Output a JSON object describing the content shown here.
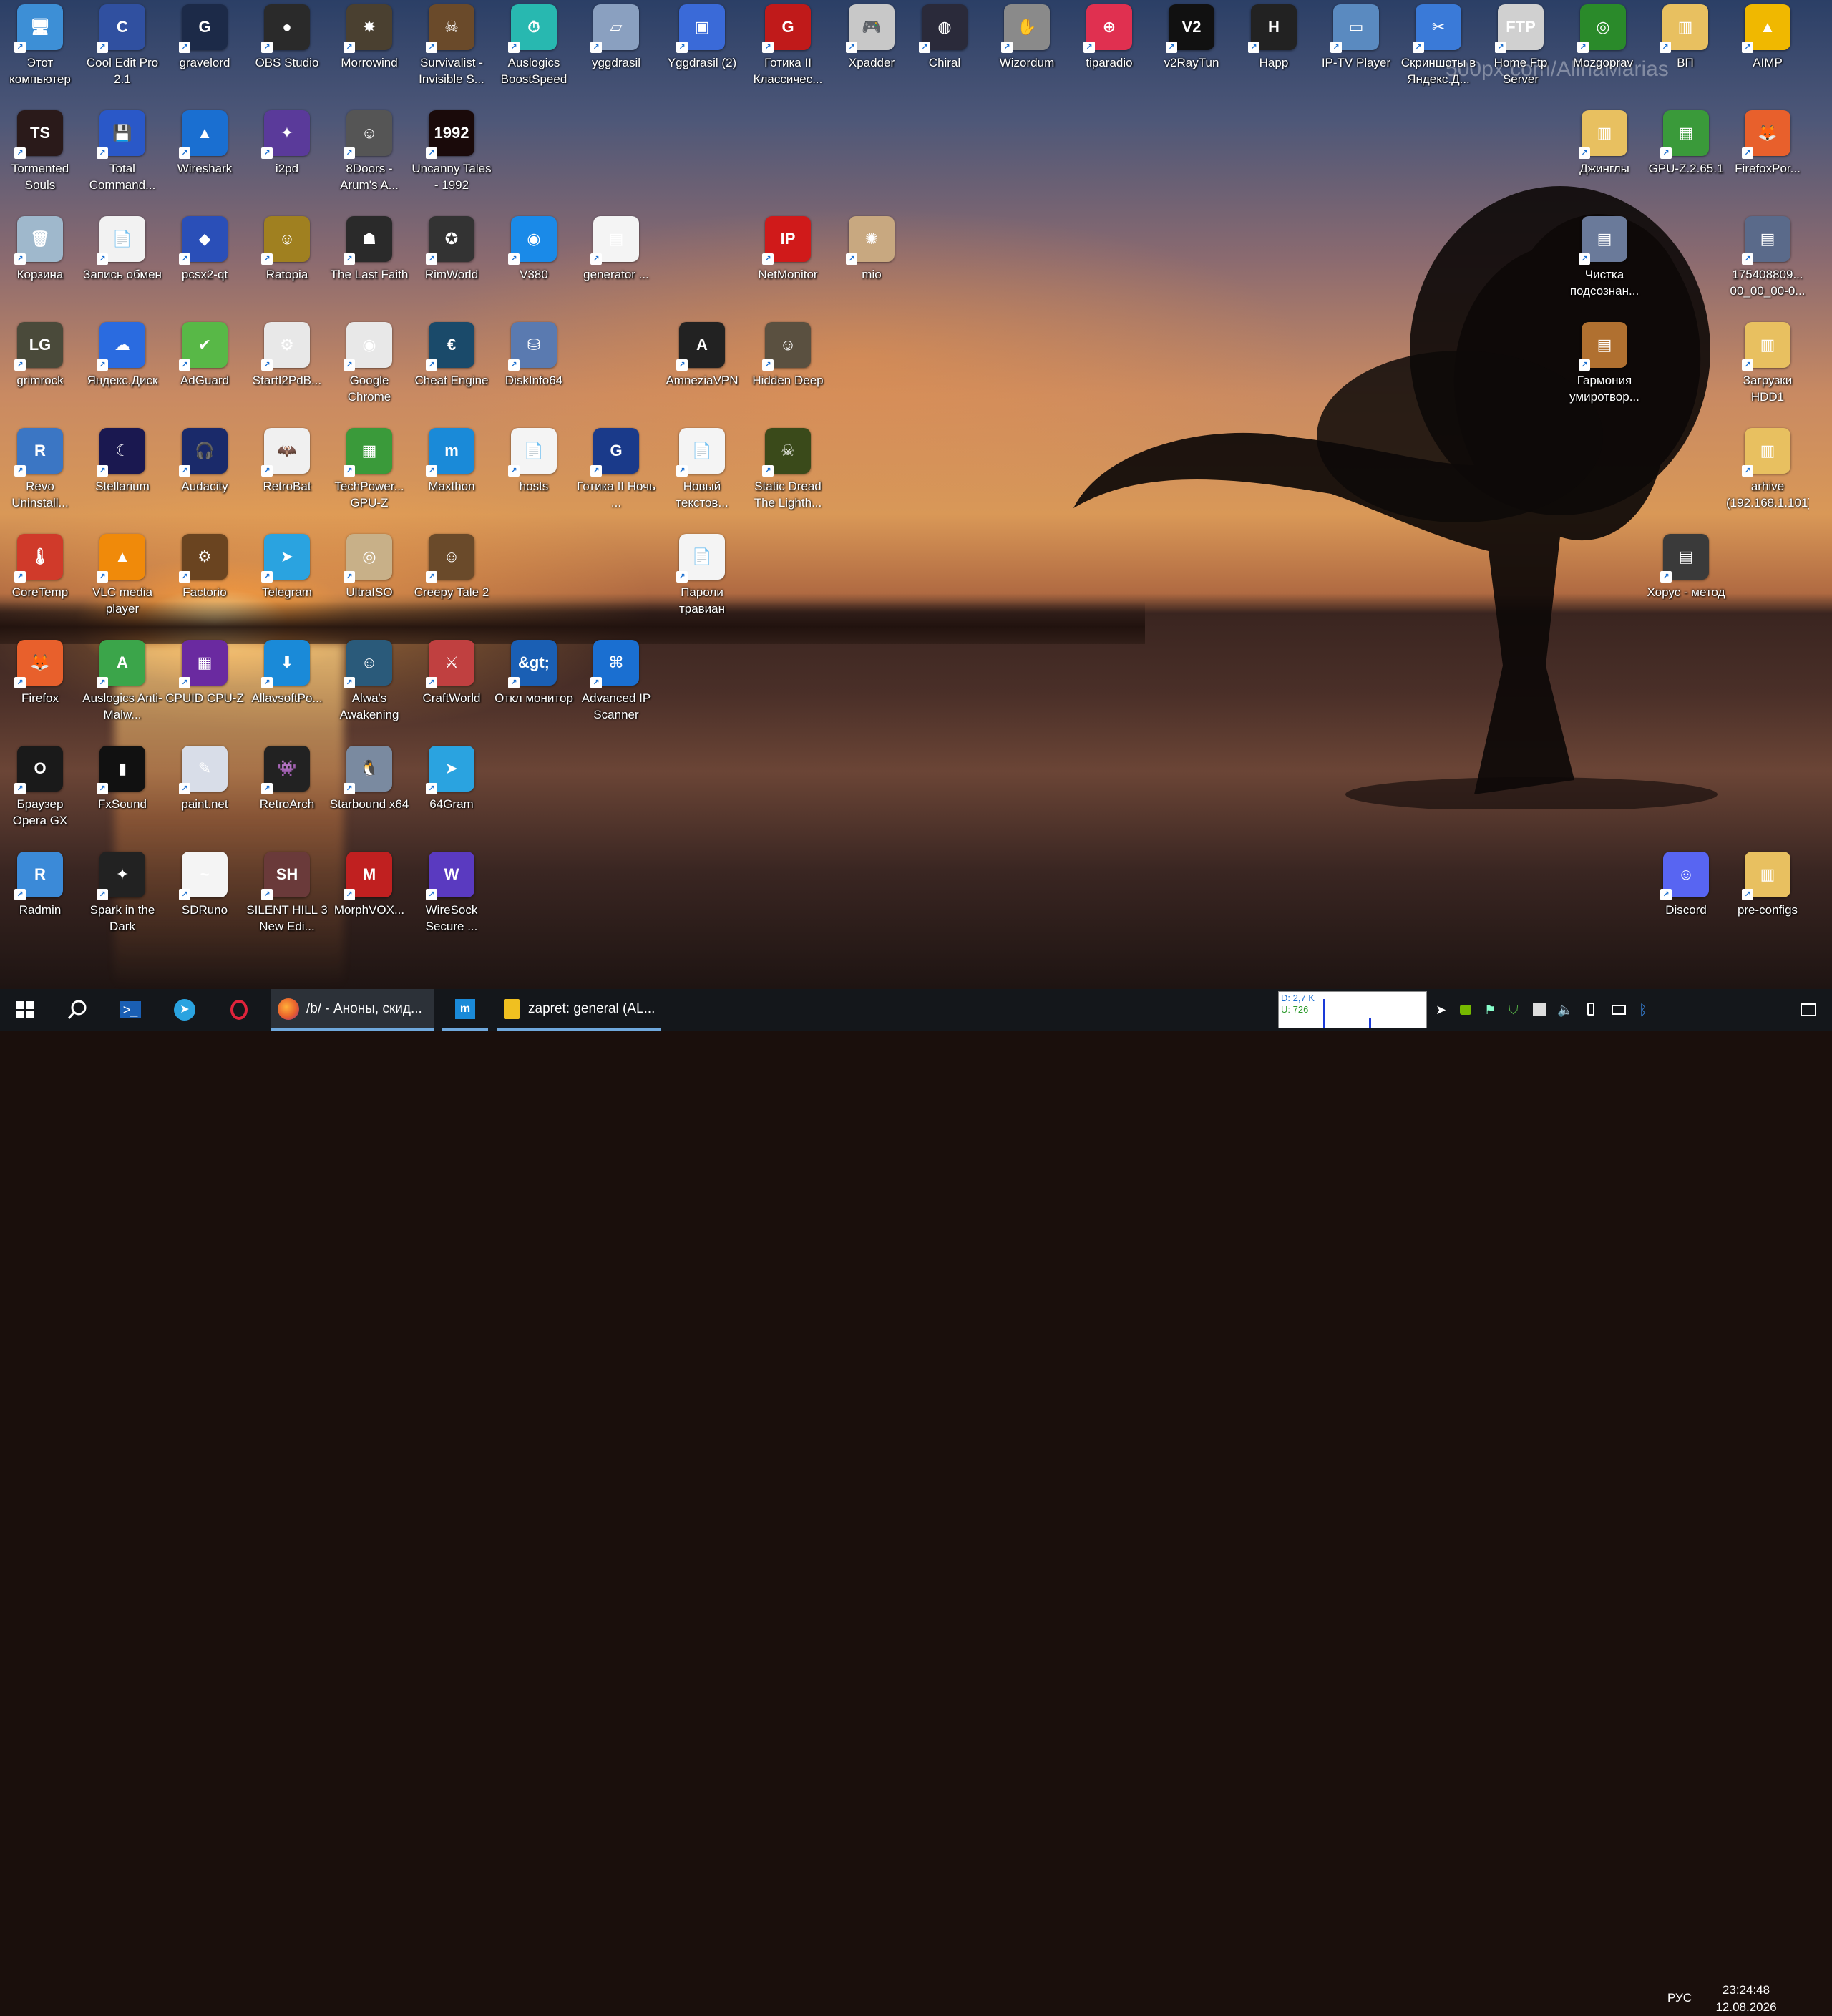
{
  "watermark": "500px.com/AlinaMarias",
  "icons_col1": [
    {
      "label": "Этот компьютер",
      "icon": "computer-icon",
      "color": "#3d8fd6",
      "g": "🖥"
    },
    {
      "label": "Tormented Souls",
      "icon": "game-icon",
      "color": "#2a1a1a",
      "g": "TS"
    },
    {
      "label": "Корзина",
      "icon": "recycle-bin-icon",
      "color": "#9fb8cc",
      "g": "🗑"
    },
    {
      "label": "grimrock",
      "icon": "game-icon",
      "color": "#4a4a3a",
      "g": "LG"
    },
    {
      "label": "Revo Uninstall...",
      "icon": "uninstaller-icon",
      "color": "#3b76c4",
      "g": "R"
    },
    {
      "label": "CoreTemp",
      "icon": "thermometer-icon",
      "color": "#d03a2a",
      "g": "🌡"
    },
    {
      "label": "Firefox",
      "icon": "firefox-icon",
      "color": "#e8602c",
      "g": "🦊"
    },
    {
      "label": "Браузер Opera GX",
      "icon": "opera-icon",
      "color": "#1a1a1a",
      "g": "O"
    },
    {
      "label": "Radmin",
      "icon": "radmin-icon",
      "color": "#3b8ad8",
      "g": "R"
    }
  ],
  "icons_col2": [
    {
      "label": "Cool Edit Pro 2.1",
      "icon": "audio-editor-icon",
      "color": "#3050a0",
      "g": "C"
    },
    {
      "label": "Total Command...",
      "icon": "floppy-icon",
      "color": "#2a58c8",
      "g": "💾"
    },
    {
      "label": "Запись обмен",
      "icon": "document-icon",
      "color": "#f2f2f2",
      "g": "📄"
    },
    {
      "label": "Яндекс.Диск",
      "icon": "cloud-icon",
      "color": "#2a6be0",
      "g": "☁"
    },
    {
      "label": "Stellarium",
      "icon": "moon-icon",
      "color": "#1a1850",
      "g": "☾"
    },
    {
      "label": "VLC media player",
      "icon": "vlc-icon",
      "color": "#f08a0a",
      "g": "▲"
    },
    {
      "label": "Auslogics Anti-Malw...",
      "icon": "shield-icon",
      "color": "#3ba54a",
      "g": "A"
    },
    {
      "label": "FxSound",
      "icon": "equalizer-icon",
      "color": "#111111",
      "g": "▮"
    },
    {
      "label": "Spark in the Dark",
      "icon": "game-icon",
      "color": "#222222",
      "g": "✦"
    }
  ],
  "icons_col3": [
    {
      "label": "gravelord",
      "icon": "game-icon",
      "color": "#1c2a48",
      "g": "G"
    },
    {
      "label": "Wireshark",
      "icon": "shark-fin-icon",
      "color": "#1a6fd1",
      "g": "▲"
    },
    {
      "label": "pcsx2-qt",
      "icon": "playstation-icon",
      "color": "#2a4fb8",
      "g": "◆"
    },
    {
      "label": "AdGuard",
      "icon": "shield-check-icon",
      "color": "#58b847",
      "g": "✔"
    },
    {
      "label": "Audacity",
      "icon": "headphones-icon",
      "color": "#1a2a6a",
      "g": "🎧"
    },
    {
      "label": "Factorio",
      "icon": "gear-icon",
      "color": "#6a4420",
      "g": "⚙"
    },
    {
      "label": "CPUID CPU-Z",
      "icon": "chip-icon",
      "color": "#6a2aa0",
      "g": "▦"
    },
    {
      "label": "paint.net",
      "icon": "paint-icon",
      "color": "#d8dde8",
      "g": "✎"
    },
    {
      "label": "SDRuno",
      "icon": "radio-icon",
      "color": "#f4f4f4",
      "g": "~"
    }
  ],
  "icons_col4": [
    {
      "label": "OBS Studio",
      "icon": "obs-icon",
      "color": "#2a2a2a",
      "g": "●"
    },
    {
      "label": "i2pd",
      "icon": "jester-icon",
      "color": "#5a3a9a",
      "g": "✦"
    },
    {
      "label": "Ratopia",
      "icon": "game-icon",
      "color": "#a08020",
      "g": "☺"
    },
    {
      "label": "StartI2PdB...",
      "icon": "settings-file-icon",
      "color": "#e8e8e8",
      "g": "⚙"
    },
    {
      "label": "RetroBat",
      "icon": "bat-icon",
      "color": "#f0f0f0",
      "g": "🦇"
    },
    {
      "label": "Telegram",
      "icon": "telegram-icon",
      "color": "#2aa3e0",
      "g": "➤"
    },
    {
      "label": "AllavsoftPo...",
      "icon": "download-icon",
      "color": "#1a8ad8",
      "g": "⬇"
    },
    {
      "label": "RetroArch",
      "icon": "gamepad-icon",
      "color": "#222222",
      "g": "👾"
    },
    {
      "label": "SILENT HILL 3 New Edi...",
      "icon": "game-icon",
      "color": "#6a3a3a",
      "g": "SH"
    }
  ],
  "icons_col5": [
    {
      "label": "Morrowind",
      "icon": "game-icon",
      "color": "#4a4030",
      "g": "✸"
    },
    {
      "label": "8Doors - Arum's A...",
      "icon": "game-icon",
      "color": "#555555",
      "g": "☺"
    },
    {
      "label": "The Last Faith",
      "icon": "game-icon",
      "color": "#2a2a2a",
      "g": "☗"
    },
    {
      "label": "Google Chrome",
      "icon": "chrome-icon",
      "color": "#e8e8e8",
      "g": "◉"
    },
    {
      "label": "TechPower... GPU-Z",
      "icon": "gpu-icon",
      "color": "#3a9a3a",
      "g": "▦"
    },
    {
      "label": "UltraISO",
      "icon": "disc-icon",
      "color": "#c8b088",
      "g": "◎"
    },
    {
      "label": "Alwa's Awakening",
      "icon": "game-icon",
      "color": "#2a5a7a",
      "g": "☺"
    },
    {
      "label": "Starbound x64",
      "icon": "penguin-icon",
      "color": "#7a8aa0",
      "g": "🐧"
    },
    {
      "label": "MorphVOX...",
      "icon": "morph-icon",
      "color": "#c02020",
      "g": "M"
    }
  ],
  "icons_col6": [
    {
      "label": "Survivalist - Invisible S...",
      "icon": "game-icon",
      "color": "#6a4a2a",
      "g": "☠"
    },
    {
      "label": "Uncanny Tales - 1992",
      "icon": "game-icon",
      "color": "#1a0a0a",
      "g": "1992"
    },
    {
      "label": "RimWorld",
      "icon": "rimworld-icon",
      "color": "#333333",
      "g": "✪"
    },
    {
      "label": "Cheat Engine",
      "icon": "cheat-engine-icon",
      "color": "#1a4a6a",
      "g": "€"
    },
    {
      "label": "Maxthon",
      "icon": "maxthon-icon",
      "color": "#1a8ad8",
      "g": "m"
    },
    {
      "label": "Creepy Tale 2",
      "icon": "game-icon",
      "color": "#6a4a2a",
      "g": "☺"
    },
    {
      "label": "CraftWorld",
      "icon": "game-icon",
      "color": "#c04040",
      "g": "⚔"
    },
    {
      "label": "64Gram",
      "icon": "telegram-icon",
      "color": "#2aa3e0",
      "g": "➤"
    },
    {
      "label": "WireSock Secure ...",
      "icon": "wiresock-icon",
      "color": "#5a3ac0",
      "g": "W"
    }
  ],
  "icons_col7": [
    {
      "label": "Auslogics BoostSpeed",
      "icon": "stopwatch-icon",
      "color": "#28b8b0",
      "g": "⏱"
    },
    {
      "label": "V380",
      "icon": "camera-icon",
      "color": "#1a8ae8",
      "g": "◉"
    },
    {
      "label": "DiskInfo64",
      "icon": "disk-icon",
      "color": "#5a7ab0",
      "g": "⛁"
    },
    {
      "label": "hosts",
      "icon": "file-icon",
      "color": "#f4f4f4",
      "g": "📄"
    },
    {
      "label": "Откл монитор",
      "icon": "powershell-icon",
      "color": "#1a5fb4",
      "g": "&gt;"
    }
  ],
  "icons_col8": [
    {
      "label": "yggdrasil",
      "icon": "app-icon",
      "color": "#8aa0c0",
      "g": "▱"
    },
    {
      "label": "generator ...",
      "icon": "document-icon",
      "color": "#f4f4f4",
      "g": "▤"
    },
    {
      "label": "Готика II Ночь ...",
      "icon": "gothic-icon",
      "color": "#1a3a8a",
      "g": "G"
    },
    {
      "label": "Advanced IP Scanner",
      "icon": "network-icon",
      "color": "#1a6fd1",
      "g": "⌘"
    }
  ],
  "icons_col9": [
    {
      "label": "Yggdrasil (2)",
      "icon": "app-icon",
      "color": "#3a6ad8",
      "g": "▣"
    },
    {
      "label": "Новый текстов...",
      "icon": "text-file-icon",
      "color": "#f4f4f4",
      "g": "📄"
    },
    {
      "label": "Пароли травиан",
      "icon": "text-file-icon",
      "color": "#f4f4f4",
      "g": "📄"
    },
    {
      "label": "AmneziaVPN",
      "icon": "vpn-icon",
      "color": "#222222",
      "g": "A"
    }
  ],
  "icons_col10": [
    {
      "label": "Готика II Классичес...",
      "icon": "gothic-icon",
      "color": "#c01a1a",
      "g": "G"
    },
    {
      "label": "NetMonitor",
      "icon": "ip-icon",
      "color": "#d01a1a",
      "g": "IP"
    },
    {
      "label": "Hidden Deep",
      "icon": "game-icon",
      "color": "#5a5040",
      "g": "☺"
    },
    {
      "label": "Static Dread The Lighth...",
      "icon": "game-icon",
      "color": "#3a4a1a",
      "g": "☠"
    }
  ],
  "icons_col11": [
    {
      "label": "Xpadder",
      "icon": "gamepad-icon",
      "color": "#c8c8c8",
      "g": "🎮"
    },
    {
      "label": "mio",
      "icon": "sun-icon",
      "color": "#c8a880",
      "g": "✺"
    }
  ],
  "icons_top_rest": [
    {
      "label": "Chiral",
      "icon": "game-icon",
      "color": "#2a2a3a",
      "g": "◍"
    },
    {
      "label": "Wizordum",
      "icon": "game-icon",
      "color": "#8a8a8a",
      "g": "✋"
    },
    {
      "label": "tiparadio",
      "icon": "radio-icon",
      "color": "#e03050",
      "g": "⊕"
    },
    {
      "label": "v2RayTun",
      "icon": "v2ray-icon",
      "color": "#111111",
      "g": "V2"
    },
    {
      "label": "Happ",
      "icon": "happ-icon",
      "color": "#222222",
      "g": "H"
    },
    {
      "label": "IP-TV Player",
      "icon": "tv-icon",
      "color": "#5a8ac0",
      "g": "▭"
    },
    {
      "label": "Скриншоты в Яндекс.Д...",
      "icon": "scissors-icon",
      "color": "#3a7ad8",
      "g": "✂"
    },
    {
      "label": "Home Ftp Server",
      "icon": "ftp-icon",
      "color": "#d0d0d0",
      "g": "FTP"
    },
    {
      "label": "Mozgoprav",
      "icon": "target-icon",
      "color": "#2a8a2a",
      "g": "◎"
    },
    {
      "label": "ВП",
      "icon": "folder-icon",
      "color": "#e8c060",
      "g": "▥"
    },
    {
      "label": "AIMP",
      "icon": "aimp-icon",
      "color": "#f0b800",
      "g": "▲"
    }
  ],
  "icons_right": [
    {
      "label": "Джинглы",
      "icon": "folder-icon",
      "color": "#e8c060",
      "g": "▥"
    },
    {
      "label": "GPU-Z.2.65.1",
      "icon": "gpu-icon",
      "color": "#3a9a3a",
      "g": "▦"
    },
    {
      "label": "FirefoxPor...",
      "icon": "firefox-icon",
      "color": "#e8602c",
      "g": "🦊"
    },
    {
      "label": "Чистка подсознан...",
      "icon": "video-icon",
      "color": "#6a7a9a",
      "g": "▤"
    },
    {
      "label": "175408809... 00_00_00-0...",
      "icon": "video-icon",
      "color": "#5a6a8a",
      "g": "▤"
    },
    {
      "label": "Гармония умиротвор...",
      "icon": "video-icon",
      "color": "#b07030",
      "g": "▤"
    },
    {
      "label": "Загрузки HDD1",
      "icon": "folder-icon",
      "color": "#e8c060",
      "g": "▥"
    },
    {
      "label": "arhive (192.168.1.101)",
      "icon": "network-folder-icon",
      "color": "#e8c060",
      "g": "▥"
    },
    {
      "label": "Хорус - метод",
      "icon": "video-icon",
      "color": "#3a3a3a",
      "g": "▤"
    },
    {
      "label": "Discord",
      "icon": "discord-icon",
      "color": "#5865f2",
      "g": "☺"
    },
    {
      "label": "pre-configs",
      "icon": "folder-icon",
      "color": "#e8c060",
      "g": "▥"
    }
  ],
  "taskbar": {
    "app1": "/b/ - Аноны, скид...",
    "app2": "zapret: general (AL..."
  },
  "tray": {
    "net_down": "D: 2,7 K",
    "net_up": "U: 726",
    "lang": "РУС",
    "time": "23:24:48",
    "date": "12.08.2026"
  }
}
